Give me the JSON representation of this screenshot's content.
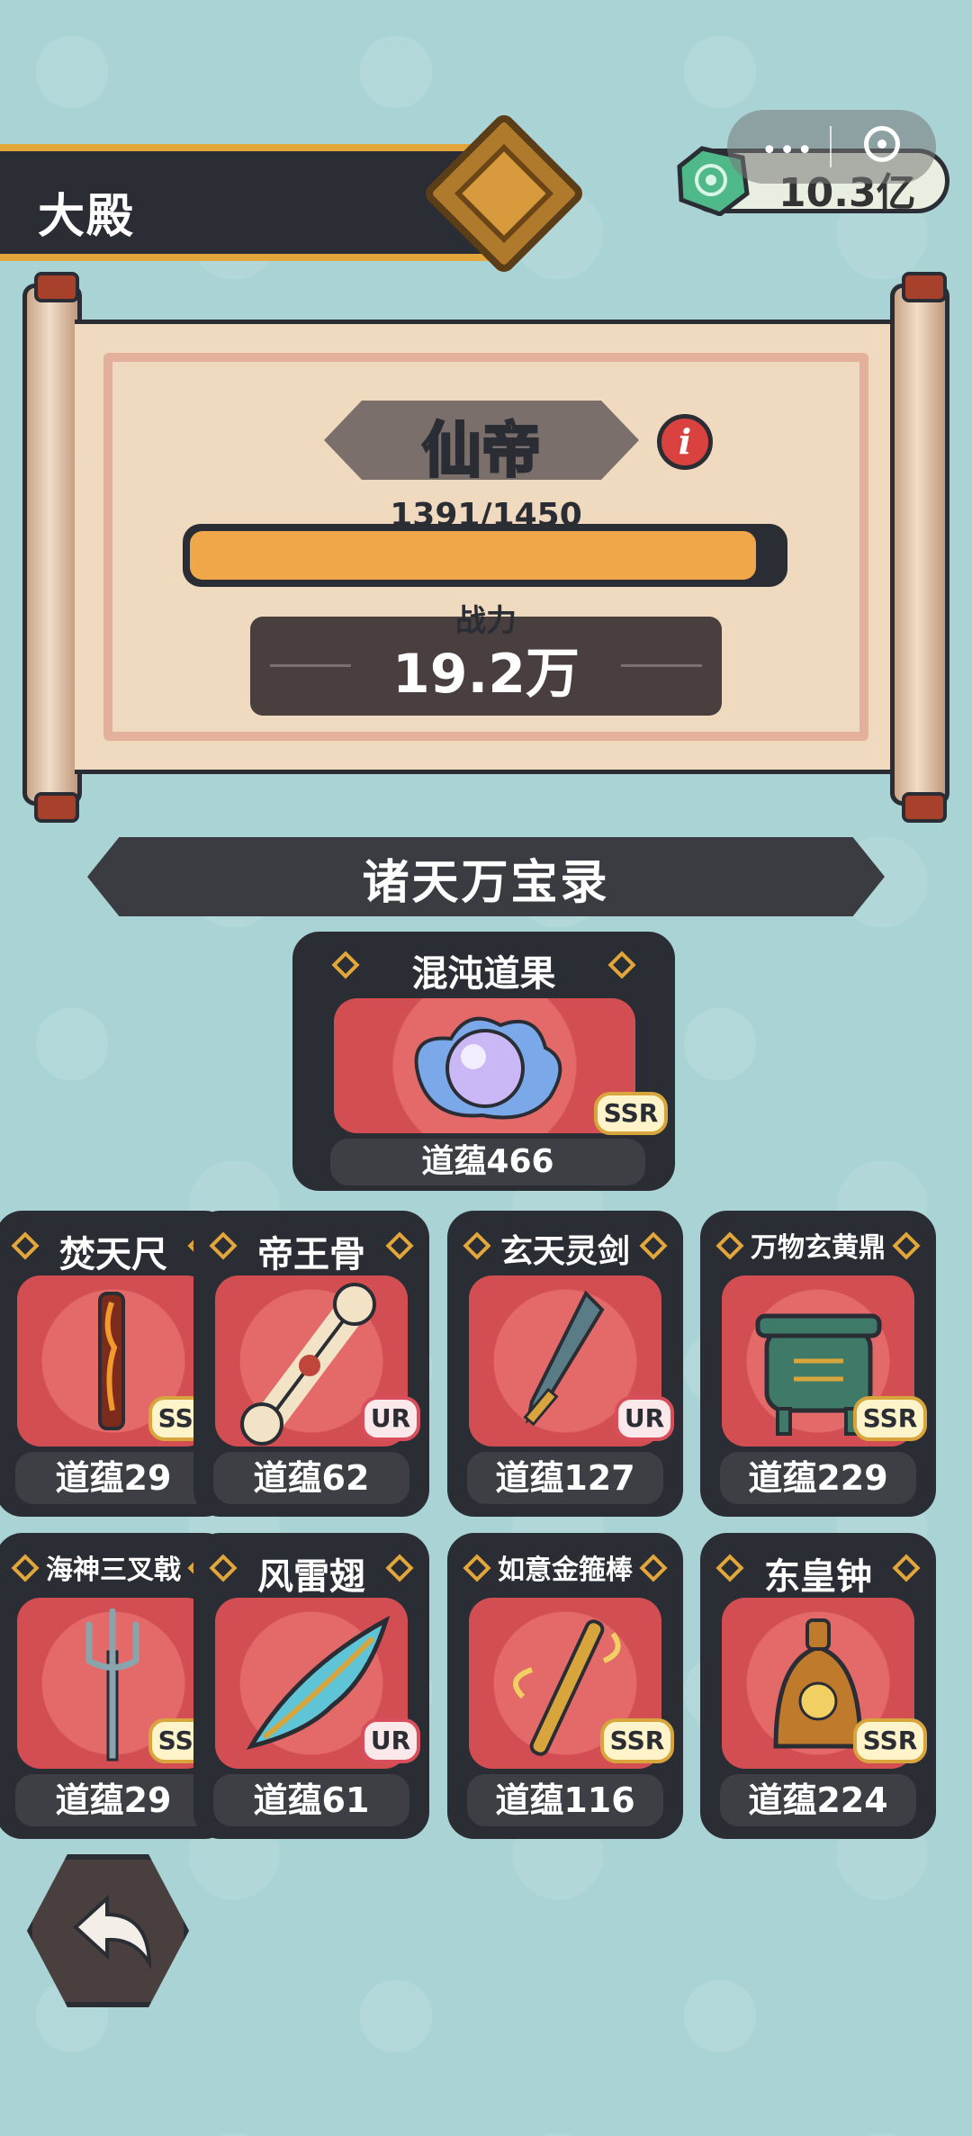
{
  "header": {
    "title": "大殿"
  },
  "currency": {
    "value": "10.3亿",
    "icon": "jade-gem-icon"
  },
  "capsule": {
    "more": "•••"
  },
  "rank": {
    "name": "仙帝",
    "progress_text": "1391/1450",
    "progress_current": 1391,
    "progress_max": 1450
  },
  "power": {
    "label": "战力",
    "value": "19.2万"
  },
  "section": {
    "title": "诸天万宝录"
  },
  "featured": {
    "name": "混沌道果",
    "tier": "SSR",
    "score": "道蕴466",
    "icon": "chaos-fruit-icon"
  },
  "treasures": [
    {
      "name": "焚天尺",
      "tier": "SSR",
      "score": "道蕴29",
      "icon": "flame-ruler-icon"
    },
    {
      "name": "帝王骨",
      "tier": "UR",
      "score": "道蕴62",
      "icon": "bone-icon"
    },
    {
      "name": "玄天灵剑",
      "tier": "UR",
      "score": "道蕴127",
      "icon": "sword-icon"
    },
    {
      "name": "万物玄黄鼎",
      "tier": "SSR",
      "score": "道蕴229",
      "icon": "cauldron-icon"
    },
    {
      "name": "海神三叉戟",
      "tier": "SSR",
      "score": "道蕴29",
      "icon": "trident-icon"
    },
    {
      "name": "风雷翅",
      "tier": "UR",
      "score": "道蕴61",
      "icon": "wing-icon"
    },
    {
      "name": "如意金箍棒",
      "tier": "SSR",
      "score": "道蕴116",
      "icon": "golden-staff-icon"
    },
    {
      "name": "东皇钟",
      "tier": "SSR",
      "score": "道蕴224",
      "icon": "bell-icon"
    }
  ]
}
